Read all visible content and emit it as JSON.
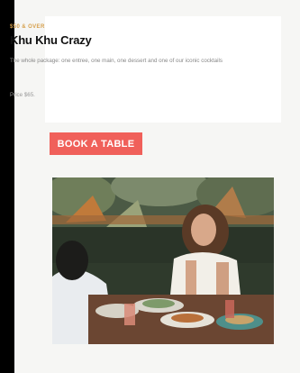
{
  "card": {
    "kicker": "$50 & OVER",
    "title": "Khu Khu Crazy",
    "description": "The whole package: one entree, one main, one dessert and one of our iconic cocktails",
    "price": "Price $65."
  },
  "cta": {
    "label": "BOOK A TABLE"
  },
  "colors": {
    "accent": "#f0605a",
    "kicker": "#d6a04d",
    "background": "#f6f6f4"
  }
}
